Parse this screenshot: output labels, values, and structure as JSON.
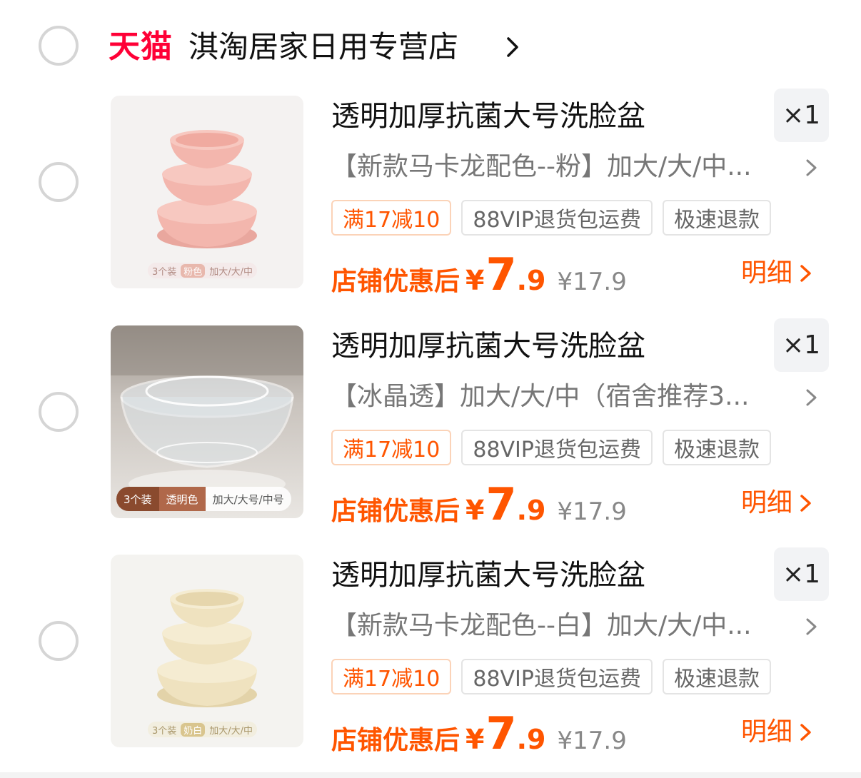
{
  "store": {
    "platform": "天猫",
    "name": "淇淘居家日用专营店"
  },
  "items": [
    {
      "title": "透明加厚抗菌大号洗脸盆",
      "sku": "【新款马卡龙配色--粉】加大/大/中...",
      "quantity": "×1",
      "tags": [
        "满17减10",
        "88VIP退货包运费",
        "极速退款"
      ],
      "price_label": "店铺优惠后",
      "currency": "¥",
      "price_int": "7",
      "price_dec": ".9",
      "original_price": "¥17.9",
      "detail_label": "明细",
      "image_sticker": [
        "3个装",
        "粉色",
        "加大/大/中"
      ],
      "bowl_color": "#f3b6ad"
    },
    {
      "title": "透明加厚抗菌大号洗脸盆",
      "sku": "【冰晶透】加大/大/中（宿舍推荐3...",
      "quantity": "×1",
      "tags": [
        "满17减10",
        "88VIP退货包运费",
        "极速退款"
      ],
      "price_label": "店铺优惠后",
      "currency": "¥",
      "price_int": "7",
      "price_dec": ".9",
      "original_price": "¥17.9",
      "detail_label": "明细",
      "image_sticker": [
        "3个装",
        "透明色",
        "加大/大号/中号"
      ],
      "bowl_color": "#dfe6ea"
    },
    {
      "title": "透明加厚抗菌大号洗脸盆",
      "sku": "【新款马卡龙配色--白】加大/大/中...",
      "quantity": "×1",
      "tags": [
        "满17减10",
        "88VIP退货包运费",
        "极速退款"
      ],
      "price_label": "店铺优惠后",
      "currency": "¥",
      "price_int": "7",
      "price_dec": ".9",
      "original_price": "¥17.9",
      "detail_label": "明细",
      "image_sticker": [
        "3个装",
        "奶白",
        "加大/大/中"
      ],
      "bowl_color": "#efe2bf"
    }
  ],
  "colors": {
    "accent": "#ff5500",
    "tmall": "#ff0036"
  },
  "icons": {
    "store_chevron": "chevron-right-icon",
    "sku_chevron": "chevron-right-icon",
    "detail_chevron": "chevron-right-icon",
    "select": "radio-circle-icon"
  }
}
